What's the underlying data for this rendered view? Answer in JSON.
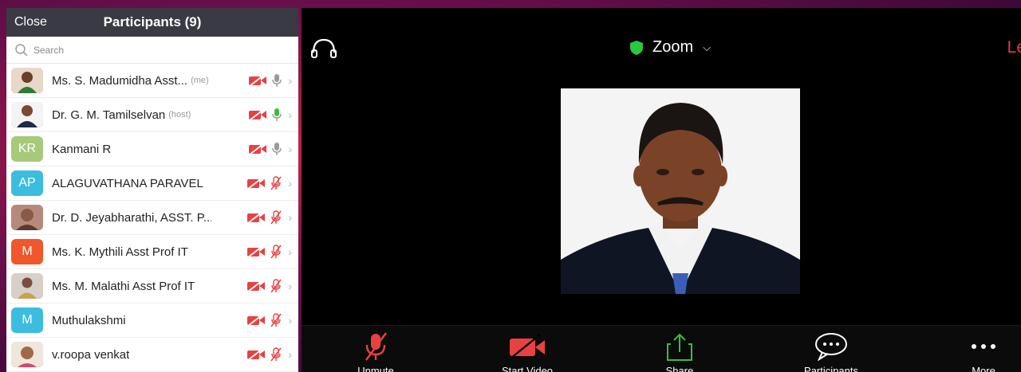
{
  "panel": {
    "close_label": "Close",
    "title": "Participants (9)",
    "search_placeholder": "Search"
  },
  "participants": [
    {
      "name": "Ms. S. Madumidha Asst...",
      "tag": "(me)",
      "avatar_type": "photo",
      "mic": "on-gray",
      "video": "off"
    },
    {
      "name": "Dr. G. M. Tamilselvan",
      "tag": "(host)",
      "avatar_type": "photo",
      "mic": "active-green",
      "video": "off"
    },
    {
      "name": "Kanmani R",
      "avatar_initials": "KR",
      "avatar_color": "#a7c97a",
      "mic": "on-gray",
      "video": "off"
    },
    {
      "name": "ALAGUVATHANA PARAVEL",
      "avatar_initials": "AP",
      "avatar_color": "#3cbde0",
      "mic": "muted",
      "video": "off"
    },
    {
      "name": "Dr. D. Jeyabharathi, ASST. P...",
      "avatar_type": "photo",
      "mic": "muted",
      "video": "off"
    },
    {
      "name": "Ms. K. Mythili Asst Prof IT",
      "avatar_initials": "M",
      "avatar_color": "#f0572a",
      "mic": "muted",
      "video": "off"
    },
    {
      "name": "Ms. M. Malathi Asst Prof IT",
      "avatar_type": "photo",
      "mic": "muted",
      "video": "off"
    },
    {
      "name": "Muthulakshmi",
      "avatar_initials": "M",
      "avatar_color": "#3cbde0",
      "mic": "muted",
      "video": "off"
    },
    {
      "name": "v.roopa venkat",
      "avatar_type": "photo",
      "mic": "muted",
      "video": "off"
    }
  ],
  "meeting": {
    "title": "Zoom",
    "leave_label": "Le",
    "shield_color": "#27c93f",
    "leave_color": "#e33d3d"
  },
  "toolbar": {
    "unmute_label": "Unmute",
    "start_video_label": "Start Video",
    "share_label": "Share",
    "participants_label": "Participants",
    "more_label": "More"
  },
  "colors": {
    "header_bg": "#3a3a44",
    "muted_red": "#e84141",
    "active_green": "#3bbd3b"
  }
}
